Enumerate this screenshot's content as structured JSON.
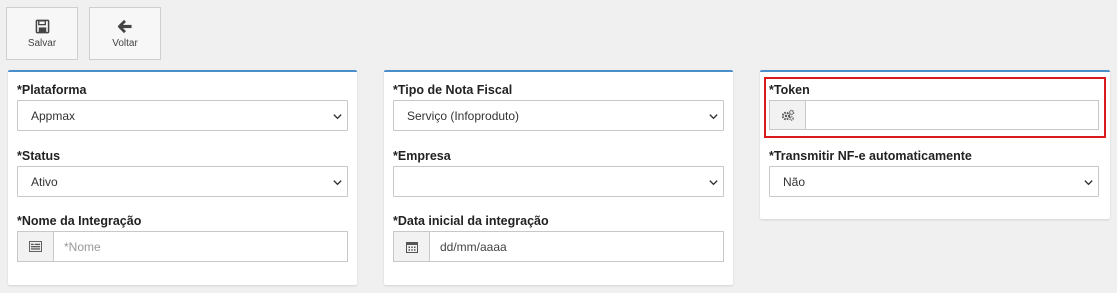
{
  "toolbar": {
    "save": {
      "label": "Salvar",
      "icon": "save-icon"
    },
    "back": {
      "label": "Voltar",
      "icon": "arrow-left-icon"
    }
  },
  "colors": {
    "panel_accent": "#4a8fc9",
    "highlight": "#d81b1b"
  },
  "col1": {
    "plataforma": {
      "label": "*Plataforma",
      "value": "Appmax"
    },
    "status": {
      "label": "*Status",
      "value": "Ativo"
    },
    "nome": {
      "label": "*Nome da Integração",
      "placeholder": "*Nome",
      "icon": "id-card-icon"
    }
  },
  "col2": {
    "tipo_nota": {
      "label": "*Tipo de Nota Fiscal",
      "value": "Serviço (Infoproduto)"
    },
    "empresa": {
      "label": "*Empresa",
      "value": ""
    },
    "data_inicial": {
      "label": "*Data inicial da integração",
      "placeholder": "dd/mm/aaaa",
      "icon": "calendar-icon"
    }
  },
  "col3": {
    "token": {
      "label": "*Token",
      "value": "",
      "icon": "gears-icon"
    },
    "transmitir": {
      "label": "*Transmitir NF-e automaticamente",
      "value": "Não"
    }
  }
}
